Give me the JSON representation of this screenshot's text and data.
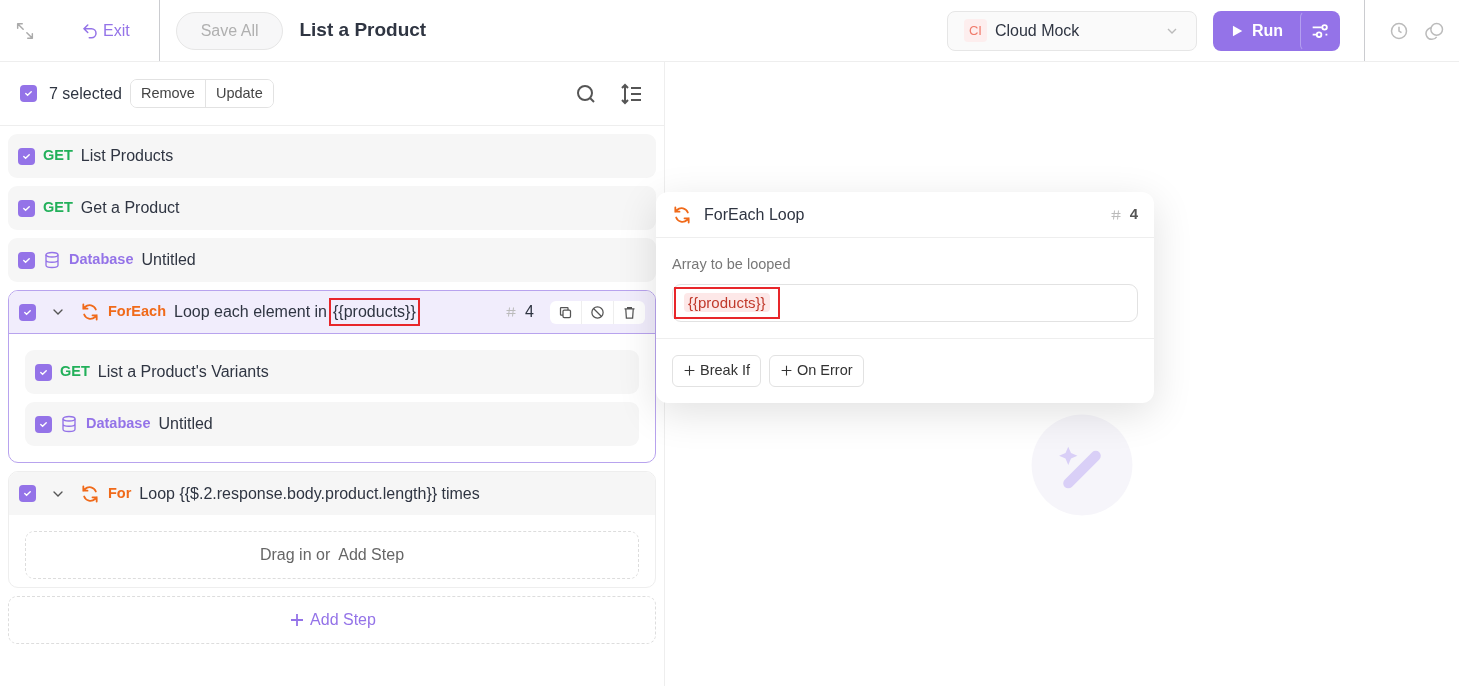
{
  "toolbar": {
    "exit": "Exit",
    "save": {
      "label": "Save All",
      "disabled": true
    },
    "title": "List a Product",
    "environment": {
      "badge": "CI",
      "name": "Cloud Mock"
    },
    "run": "Run"
  },
  "selection": {
    "checked": true,
    "count": "7 selected",
    "actions": [
      "Remove",
      "Update"
    ]
  },
  "steps": [
    {
      "kind": "request",
      "checked": true,
      "label": "GET",
      "name": "List Products"
    },
    {
      "kind": "request",
      "checked": true,
      "label": "GET",
      "name": "Get a Product"
    },
    {
      "kind": "database",
      "checked": true,
      "label": "Database",
      "name": "Untitled"
    },
    {
      "kind": "foreach",
      "checked": true,
      "selected": true,
      "expanded": true,
      "label": "ForEach",
      "name": "Loop each element in",
      "variable": "{{products}}",
      "variable_highlighted": true,
      "number": "4",
      "children": [
        {
          "kind": "request",
          "checked": true,
          "label": "GET",
          "name": "List a Product's Variants"
        },
        {
          "kind": "database",
          "checked": true,
          "label": "Database",
          "name": "Untitled"
        }
      ]
    },
    {
      "kind": "for",
      "checked": true,
      "selected": false,
      "expanded": true,
      "label": "For",
      "name": "Loop {{$.2.response.body.product.length}} times",
      "empty": {
        "text": "Drag in or",
        "action": "Add Step"
      }
    }
  ],
  "add_step": "Add Step",
  "panel": {
    "title": "ForEach Loop",
    "number": "4",
    "field_label": "Array to be looped",
    "value": "{{products}}",
    "value_highlighted": true,
    "buttons": [
      "Break If",
      "On Error"
    ]
  }
}
